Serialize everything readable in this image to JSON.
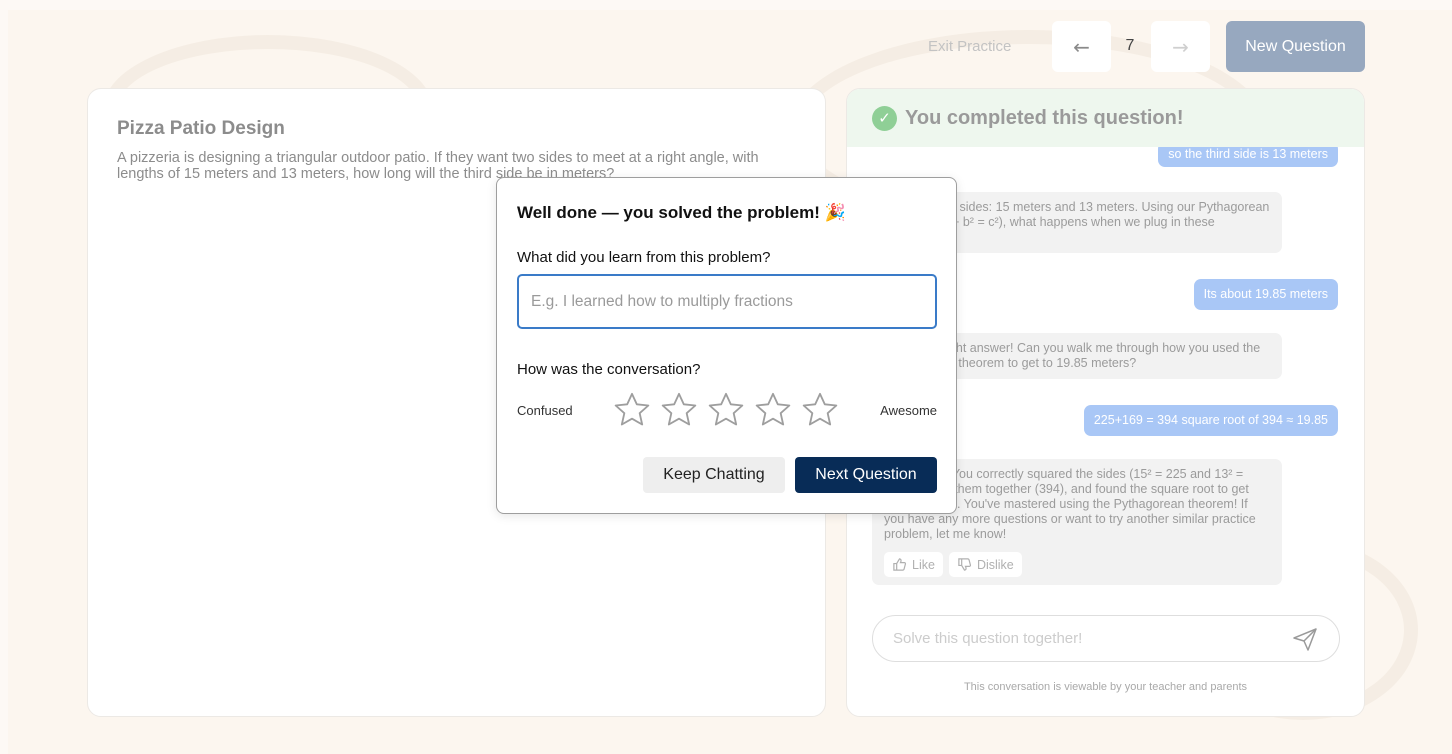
{
  "toolbar": {
    "exit_label": "Exit Practice",
    "prev_icon": "arrow-left-icon",
    "page_number": "7",
    "next_icon": "arrow-right-icon",
    "new_question_label": "New Question"
  },
  "question": {
    "title": "Pizza Patio Design",
    "body": "A pizzeria is designing a triangular outdoor patio. If they want two sides to meet at a right angle, with lengths of 15 meters and 13 meters, how long will the third side be in meters?"
  },
  "chat": {
    "completed_text": "You completed this question!",
    "messages": [
      {
        "role": "user",
        "text": "so the third side is 13 meters"
      },
      {
        "role": "bot",
        "text": "We have two sides: 15 meters and 13 meters. Using our Pythagorean theorem (a² + b² = c²), what happens when we plug in these numbers?"
      },
      {
        "role": "user",
        "text": "Its about 19.85 meters"
      },
      {
        "role": "bot",
        "text": "That's the right answer! Can you walk me through how you used the Pythagorean theorem to get to 19.85 meters?"
      },
      {
        "role": "user",
        "text": "225+169 = 394 square root of 394 ≈ 19.85"
      },
      {
        "role": "bot",
        "text": "Great work! You correctly squared the sides (15² = 225 and 13² = 169), added them together (394), and found the square root to get 19.85 meters. You've mastered using the Pythagorean theorem! If you have any more questions or want to try another similar practice problem, let me know!"
      }
    ],
    "like_label": "Like",
    "dislike_label": "Dislike",
    "input_placeholder": "Solve this question together!",
    "viewable_note": "This conversation is viewable by your teacher and parents"
  },
  "modal": {
    "title": "Well done — you solved the problem! 🎉",
    "learn_question": "What did you learn from this problem?",
    "learn_placeholder": "E.g. I learned how to multiply fractions",
    "conversation_question": "How was the conversation?",
    "rating_low_label": "Confused",
    "rating_high_label": "Awesome",
    "rating_value": 0,
    "rating_max": 5,
    "keep_chatting_label": "Keep Chatting",
    "next_question_label": "Next Question"
  },
  "colors": {
    "accent_dark": "#082c57",
    "user_bubble": "#a9c7f6",
    "completed_green": "#8fcf96"
  }
}
